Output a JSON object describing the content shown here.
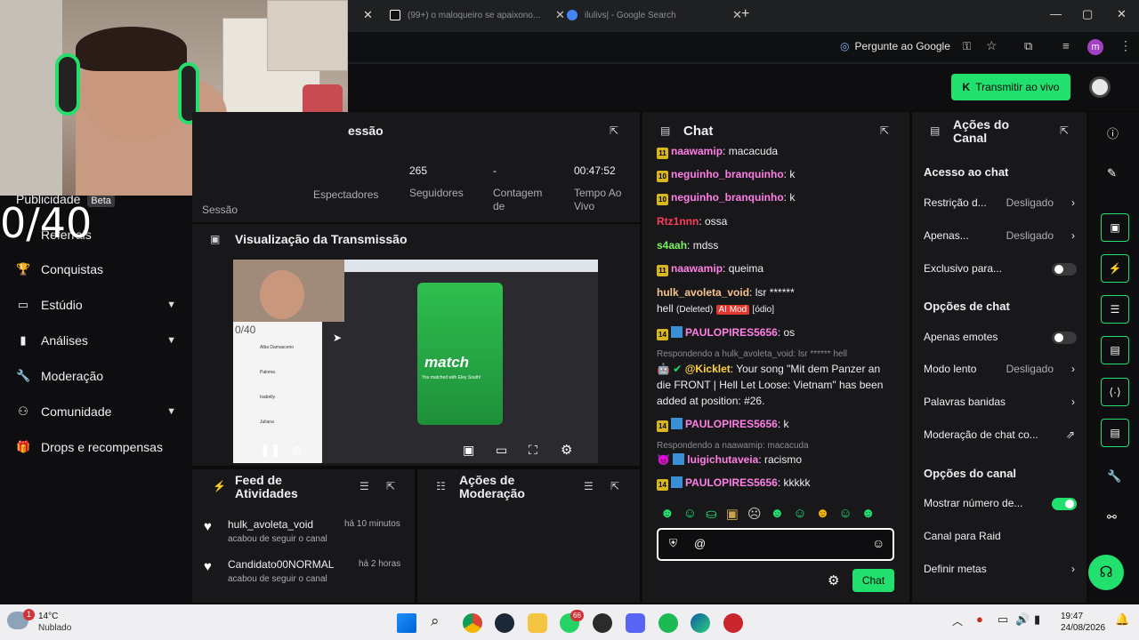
{
  "browser": {
    "tabs": [
      {
        "label": "(99+) o maloqueiro se apaixono..."
      },
      {
        "label": "ilulivs| - Google Search"
      }
    ],
    "ask_google": "Pergunte ao Google",
    "avatar_letter": "m"
  },
  "header": {
    "go_live": "Transmitir ao vivo"
  },
  "overlay": {
    "counter": "0/40"
  },
  "sidebar": {
    "partial_items": [
      "Publicidade",
      "Beta",
      "Referrals"
    ],
    "items": [
      {
        "label": "Conquistas"
      },
      {
        "label": "Estúdio"
      },
      {
        "label": "Análises"
      },
      {
        "label": "Moderação"
      },
      {
        "label": "Comunidade"
      },
      {
        "label": "Drops e recompensas"
      }
    ]
  },
  "session": {
    "title_fragment": "essão",
    "stats": [
      {
        "value": "",
        "label": "Sessão"
      },
      {
        "value": "",
        "label": "Espectadores"
      },
      {
        "value": "265",
        "label": "Seguidores"
      },
      {
        "value": "-",
        "label": "Contagem de"
      },
      {
        "value": "00:47:52",
        "label": "Tempo Ao Vivo"
      }
    ]
  },
  "preview": {
    "title": "Visualização da Transmissão",
    "match_text": "match",
    "match_sub": "You matched with Eley South!",
    "mini_counter": "0/40",
    "mini_list": [
      "Alba Damasceno",
      "Paloma",
      "Isabelly",
      "Juliana"
    ]
  },
  "feed": {
    "title": "Feed de Atividades",
    "items": [
      {
        "user": "hulk_avoleta_void",
        "time": "há 10 minutos",
        "action": "acabou de seguir o canal"
      },
      {
        "user": "Candidato00NORMAL",
        "time": "há 2 horas",
        "action": "acabou de seguir o canal"
      }
    ]
  },
  "moderation": {
    "title": "Ações de Moderação"
  },
  "chat": {
    "title": "Chat",
    "messages": [
      {
        "badge": "11",
        "user": "naawamip",
        "text": "macacuda",
        "color": "#ff7fe6"
      },
      {
        "badge": "10",
        "user": "neguinho_branquinho",
        "text": "k",
        "color": "#ff7fe6"
      },
      {
        "badge": "10",
        "user": "neguinho_branquinho",
        "text": "k",
        "color": "#ff7fe6"
      },
      {
        "badge": "",
        "user": "Rtz1nnn",
        "text": "ossa",
        "color": "#ff3b5c"
      },
      {
        "badge": "",
        "user": "s4aah",
        "text": "mdss",
        "color": "#7cf25a"
      },
      {
        "badge": "11",
        "user": "naawamip",
        "text": "queima",
        "color": "#ff7fe6"
      },
      {
        "badge": "",
        "user": "hulk_avoleta_void",
        "text": "lsr ******",
        "color": "#f7c38a"
      },
      {
        "badge": "",
        "user": "",
        "text": "hell",
        "color": "#efeff1"
      },
      {
        "badge": "14",
        "user": "PAULOPIRES5656",
        "text": "os",
        "color": "#ff7fe6"
      },
      {
        "badge": "",
        "user": "@Kicklet",
        "text": "Your song \"Mit dem Panzer an die FRONT | Hell Let Loose: Vietnam\" has been added at position: #26.",
        "color": "#ffd43b"
      },
      {
        "badge": "14",
        "user": "PAULOPIRES5656",
        "text": "k",
        "color": "#ff7fe6"
      },
      {
        "badge": "",
        "user": "luigichutaveia",
        "text": "racismo",
        "color": "#ff7fe6"
      },
      {
        "badge": "14",
        "user": "PAULOPIRES5656",
        "text": "kkkkk",
        "color": "#ff7fe6"
      }
    ],
    "deleted_tag": "(Deleted)",
    "aimod_tag": "AI Mod",
    "hate_tag": "[ódio]",
    "reply1": "Respondendo a hulk_avoleta_void: lsr ****** hell",
    "reply2": "Respondendo a naawamip: macacuda",
    "input_value": "@",
    "send_label": "Chat"
  },
  "actions": {
    "title": "Ações do Canal",
    "chat_access": {
      "title": "Acesso ao chat",
      "rows": [
        {
          "label": "Restrição d...",
          "value": "Desligado"
        },
        {
          "label": "Apenas...",
          "value": "Desligado"
        },
        {
          "label": "Exclusivo para...",
          "value": ""
        }
      ]
    },
    "chat_options": {
      "title": "Opções de chat",
      "rows": [
        {
          "label": "Apenas emotes",
          "value": ""
        },
        {
          "label": "Modo lento",
          "value": "Desligado"
        },
        {
          "label": "Palavras banidas",
          "value": ""
        },
        {
          "label": "Moderação de chat co...",
          "value": ""
        }
      ]
    },
    "channel_options": {
      "title": "Opções do canal",
      "rows": [
        {
          "label": "Mostrar número de...",
          "value": ""
        },
        {
          "label": "Canal para Raid",
          "value": ""
        },
        {
          "label": "Definir metas",
          "value": ""
        }
      ]
    }
  },
  "taskbar": {
    "weather_temp": "14°C",
    "weather_desc": "Nublado",
    "weather_badge": "1",
    "whatsapp_badge": "66",
    "time": "19:47",
    "date": "24/08/2026"
  },
  "colors": {
    "accent": "#22e06e",
    "panel": "#18181b",
    "bg": "#0e0e10"
  }
}
